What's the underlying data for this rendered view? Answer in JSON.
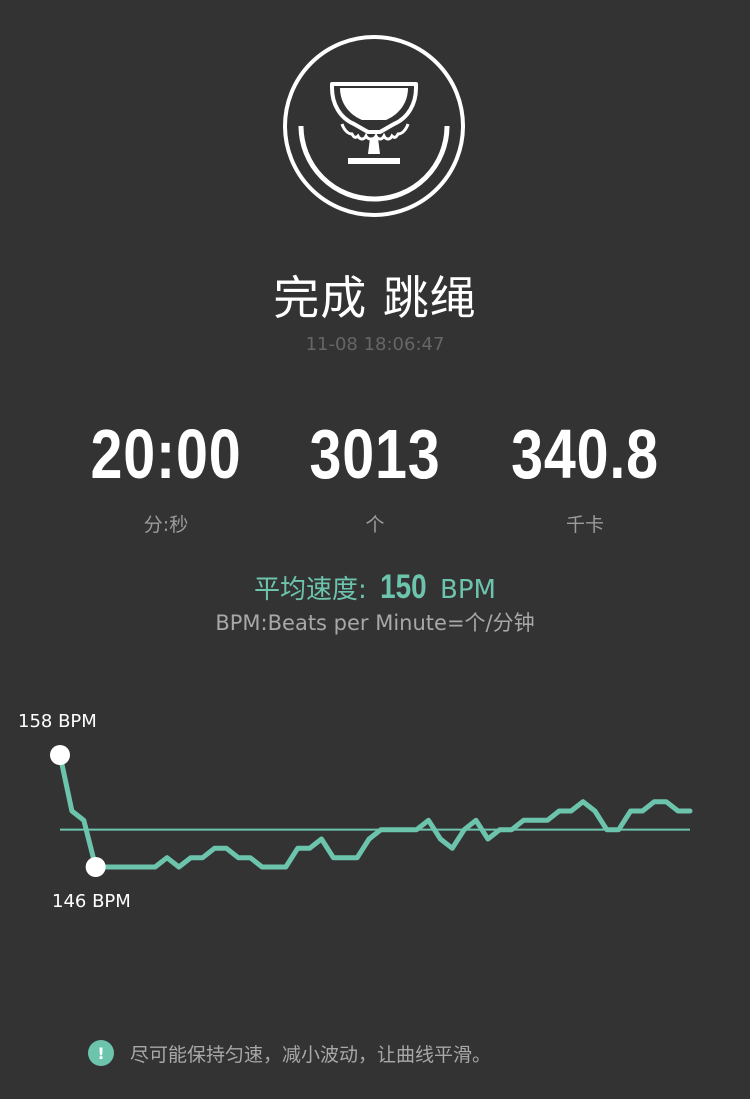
{
  "colors": {
    "background": "#333333",
    "accent": "#6dc4ad",
    "text_primary": "#ffffff",
    "text_secondary": "#9b9b9b",
    "text_dim": "#666666"
  },
  "header": {
    "badge_icon": "trophy-icon",
    "title": "完成 跳绳",
    "timestamp": "11-08 18:06:47"
  },
  "stats": [
    {
      "value": "20:00",
      "unit": "分:秒"
    },
    {
      "value": "3013",
      "unit": "个"
    },
    {
      "value": "340.8",
      "unit": "千卡"
    }
  ],
  "average": {
    "label": "平均速度:",
    "value": "150",
    "unit": "BPM",
    "note": "BPM:Beats per Minute=个/分钟"
  },
  "chart_data": {
    "type": "line",
    "max_label": "158 BPM",
    "min_label": "146 BPM",
    "max": 158,
    "min": 146,
    "average": 150,
    "values": [
      158,
      152,
      151,
      146,
      146,
      146,
      146,
      146,
      146,
      147,
      146,
      147,
      147,
      148,
      148,
      147,
      147,
      146,
      146,
      146,
      148,
      148,
      149,
      147,
      147,
      147,
      149,
      150,
      150,
      150,
      150,
      151,
      149,
      148,
      150,
      151,
      149,
      150,
      150,
      151,
      151,
      151,
      152,
      152,
      153,
      152,
      150,
      150,
      152,
      152,
      153,
      153,
      152,
      152
    ]
  },
  "tip": {
    "icon": "info-icon",
    "icon_glyph": "!",
    "text": "尽可能保持匀速，减小波动，让曲线平滑。"
  }
}
